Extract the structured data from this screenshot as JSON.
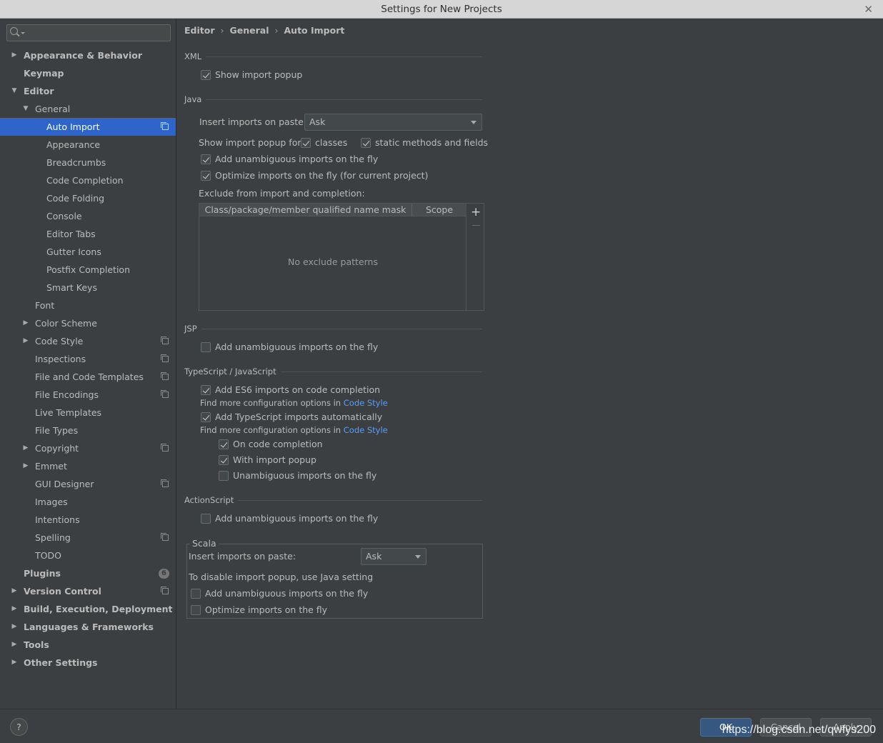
{
  "window": {
    "title": "Settings for New Projects"
  },
  "search": {
    "placeholder": "",
    "value": ""
  },
  "tree": {
    "appearance_behavior": "Appearance & Behavior",
    "keymap": "Keymap",
    "editor": "Editor",
    "general": "General",
    "general_children": [
      "Auto Import",
      "Appearance",
      "Breadcrumbs",
      "Code Completion",
      "Code Folding",
      "Console",
      "Editor Tabs",
      "Gutter Icons",
      "Postfix Completion",
      "Smart Keys"
    ],
    "font": "Font",
    "color_scheme": "Color Scheme",
    "code_style": "Code Style",
    "inspections": "Inspections",
    "file_code_templates": "File and Code Templates",
    "file_encodings": "File Encodings",
    "live_templates": "Live Templates",
    "file_types": "File Types",
    "copyright": "Copyright",
    "emmet": "Emmet",
    "gui_designer": "GUI Designer",
    "images": "Images",
    "intentions": "Intentions",
    "spelling": "Spelling",
    "todo": "TODO",
    "plugins": "Plugins",
    "plugins_badge": "6",
    "version_control": "Version Control",
    "build": "Build, Execution, Deployment",
    "languages": "Languages & Frameworks",
    "tools": "Tools",
    "other": "Other Settings"
  },
  "breadcrumb": {
    "items": [
      "Editor",
      "General",
      "Auto Import"
    ],
    "separator": "›"
  },
  "xml": {
    "title": "XML",
    "show_import_popup": {
      "label": "Show import popup",
      "checked": true
    }
  },
  "java": {
    "title": "Java",
    "insert_on_paste_label": "Insert imports on paste:",
    "insert_on_paste_value": "Ask",
    "show_popup_for_label": "Show import popup for:",
    "classes": {
      "label": "classes",
      "checked": true
    },
    "static_methods": {
      "label": "static methods and fields",
      "checked": true
    },
    "add_unambiguous": {
      "label": "Add unambiguous imports on the fly",
      "checked": true
    },
    "optimize": {
      "label": "Optimize imports on the fly (for current project)",
      "checked": true
    },
    "exclude_label": "Exclude from import and completion:",
    "table": {
      "columns": [
        "Class/package/member qualified name mask",
        "Scope"
      ],
      "empty_text": "No exclude patterns",
      "add_icon": "+",
      "remove_icon": "−"
    }
  },
  "jsp": {
    "title": "JSP",
    "add_unambiguous": {
      "label": "Add unambiguous imports on the fly",
      "checked": false
    }
  },
  "typescript": {
    "title": "TypeScript / JavaScript",
    "es6": {
      "label": "Add ES6 imports on code completion",
      "checked": true
    },
    "find_more_prefix": "Find more configuration options in",
    "find_more_link": "Code Style",
    "ts_auto": {
      "label": "Add TypeScript imports automatically",
      "checked": true
    },
    "on_code_completion": {
      "label": "On code completion",
      "checked": true
    },
    "with_import_popup": {
      "label": "With import popup",
      "checked": true
    },
    "unambiguous": {
      "label": "Unambiguous imports on the fly",
      "checked": false
    }
  },
  "actionscript": {
    "title": "ActionScript",
    "add_unambiguous": {
      "label": "Add unambiguous imports on the fly",
      "checked": false
    }
  },
  "scala": {
    "title": "Scala",
    "insert_on_paste_label": "Insert imports on paste:",
    "insert_on_paste_value": "Ask",
    "disable_note": "To disable import popup, use Java setting",
    "add_unambiguous": {
      "label": "Add unambiguous imports on the fly",
      "checked": false
    },
    "optimize": {
      "label": "Optimize imports on the fly",
      "checked": false
    }
  },
  "footer": {
    "help": "?",
    "ok": "OK",
    "cancel": "Cancel",
    "apply": "Apply",
    "watermark": "https://blog.csdn.net/qwfys200"
  },
  "colors": {
    "selection": "#2f65ca",
    "background": "#3c3f41",
    "link": "#589df6",
    "ok_button": "#365880"
  }
}
